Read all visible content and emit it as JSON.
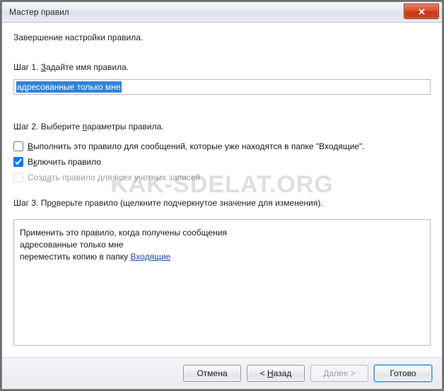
{
  "window": {
    "title": "Мастер правил",
    "close_icon": "close"
  },
  "header": "Завершение настройки правила.",
  "step1": {
    "label_pre": "Шаг 1. ",
    "label_mn": "З",
    "label_post": "адайте имя правила.",
    "value": "адресованные только мне"
  },
  "step2": {
    "label_pre": "Шаг 2. Выберите ",
    "label_mn": "п",
    "label_post": "араметры правила.",
    "opt_run": {
      "mn": "В",
      "text": "ыполнить это правило для сообщений, которые уже находятся в папке \"Входящие\".",
      "checked": false
    },
    "opt_enable": {
      "pre": "В",
      "mn": "к",
      "post": "лючить правило",
      "checked": true
    },
    "opt_all": {
      "pre": "Созд",
      "mn": "а",
      "post": "ть правило для всех учетных записей",
      "checked": false,
      "disabled": true
    }
  },
  "step3": {
    "label_pre": "Шаг 3. Пр",
    "label_mn": "о",
    "label_post": "верьте правило (щелкните подчеркнутое значение для изменения).",
    "line1": "Применить это правило, когда получены сообщения",
    "line2": "адресованные только мне",
    "line3_pre": "переместить копию в папку ",
    "line3_link": "Входящие"
  },
  "buttons": {
    "cancel": "Отмена",
    "back_pre": "< ",
    "back_mn": "Н",
    "back_post": "азад",
    "next_mn": "Д",
    "next_post": "алее >",
    "finish": "Готово"
  },
  "watermark": "KAK-SDELAT.ORG"
}
